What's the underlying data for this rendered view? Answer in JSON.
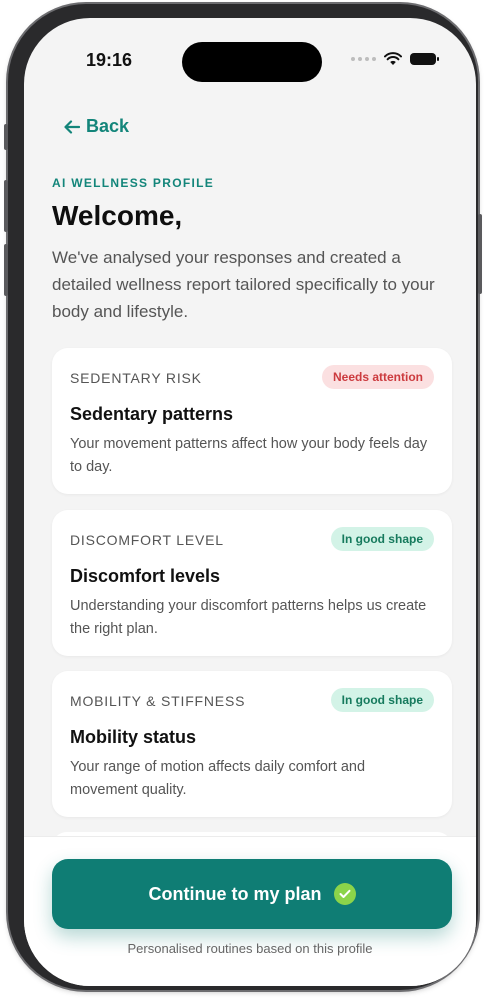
{
  "status_bar": {
    "time": "19:16"
  },
  "nav": {
    "back_label": "Back"
  },
  "header": {
    "eyebrow": "AI WELLNESS PROFILE",
    "title": "Welcome,",
    "intro": "We've analysed your responses and created a detailed wellness report tailored specifically to your body and lifestyle."
  },
  "cards": [
    {
      "category": "SEDENTARY RISK",
      "badge": "Needs attention",
      "badge_status": "warn",
      "title": "Sedentary patterns",
      "description": "Your movement patterns affect how your body feels day to day."
    },
    {
      "category": "DISCOMFORT LEVEL",
      "badge": "In good shape",
      "badge_status": "good",
      "title": "Discomfort levels",
      "description": "Understanding your discomfort patterns helps us create the right plan."
    },
    {
      "category": "MOBILITY & STIFFNESS",
      "badge": "In good shape",
      "badge_status": "good",
      "title": "Mobility status",
      "description": "Your range of motion affects daily comfort and movement quality."
    }
  ],
  "cta": {
    "label": "Continue to my plan",
    "icon": "check-circle-icon"
  },
  "footnote": "Personalised routines based on this profile",
  "colors": {
    "accent": "#13857a",
    "cta_background": "#0f7d74",
    "warn_badge_bg": "#fbe0e1",
    "warn_badge_text": "#cc3b3f",
    "good_badge_bg": "#d3f3e7",
    "good_badge_text": "#167a5d",
    "screen_background": "#f4f4f4"
  }
}
